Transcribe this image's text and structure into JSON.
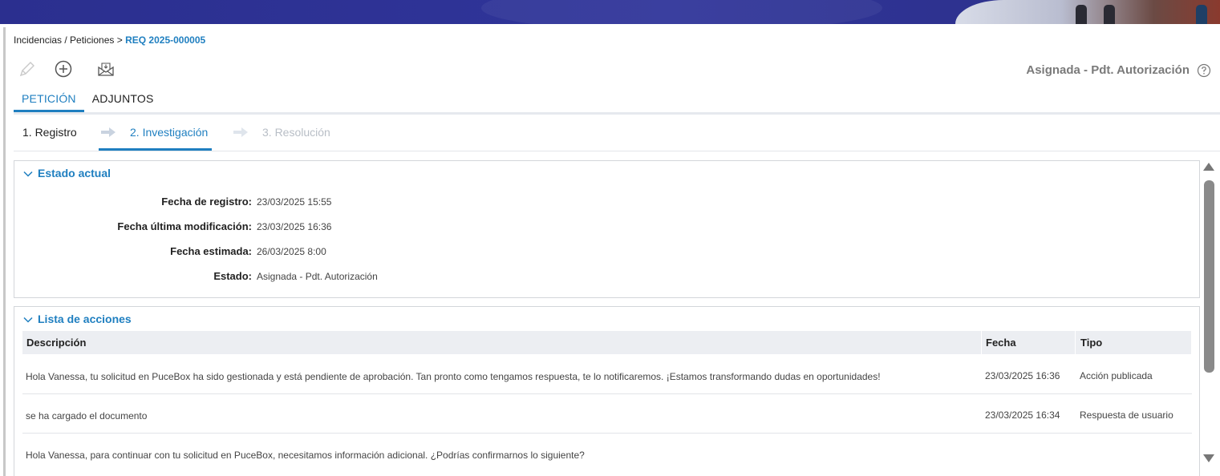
{
  "breadcrumb": {
    "path": "Incidencias / Peticiones >",
    "current": "REQ 2025-000005"
  },
  "toolbar": {
    "icons": [
      "pencil-icon",
      "add-circle-icon",
      "envelope-icon"
    ]
  },
  "header": {
    "status": "Asignada - Pdt. Autorización",
    "help_icon": "question-circle-icon"
  },
  "tabs": [
    {
      "label": "PETICIÓN",
      "active": true
    },
    {
      "label": "ADJUNTOS",
      "active": false
    }
  ],
  "steps": [
    {
      "label": "1. Registro",
      "state": "done"
    },
    {
      "label": "2. Investigación",
      "state": "current"
    },
    {
      "label": "3. Resolución",
      "state": "pending"
    }
  ],
  "estado_actual": {
    "title": "Estado actual",
    "fields": [
      {
        "label": "Fecha de registro:",
        "value": "23/03/2025 15:55"
      },
      {
        "label": "Fecha última modificación:",
        "value": "23/03/2025 16:36"
      },
      {
        "label": "Fecha estimada:",
        "value": "26/03/2025 8:00"
      },
      {
        "label": "Estado:",
        "value": "Asignada - Pdt. Autorización"
      }
    ]
  },
  "acciones": {
    "title": "Lista de acciones",
    "columns": [
      "Descripción",
      "Fecha",
      "Tipo"
    ],
    "rows": [
      {
        "descripcion": "Hola Vanessa, tu solicitud en PuceBox ha sido gestionada y está pendiente de aprobación. Tan pronto como tengamos respuesta, te lo notificaremos. ¡Estamos transformando dudas en oportunidades!",
        "fecha": "23/03/2025 16:36",
        "tipo": "Acción publicada"
      },
      {
        "descripcion": "se ha cargado el documento",
        "fecha": "23/03/2025 16:34",
        "tipo": "Respuesta de usuario"
      },
      {
        "descripcion": "Hola Vanessa, para continuar con tu solicitud en PuceBox, necesitamos información adicional. ¿Podrías confirmarnos lo siguiente?",
        "fecha": "",
        "tipo": ""
      }
    ]
  },
  "colors": {
    "accent": "#1f7fc0",
    "banner": "#2b2f8f",
    "muted": "#b8bec6",
    "header_bg": "#eceef2"
  }
}
